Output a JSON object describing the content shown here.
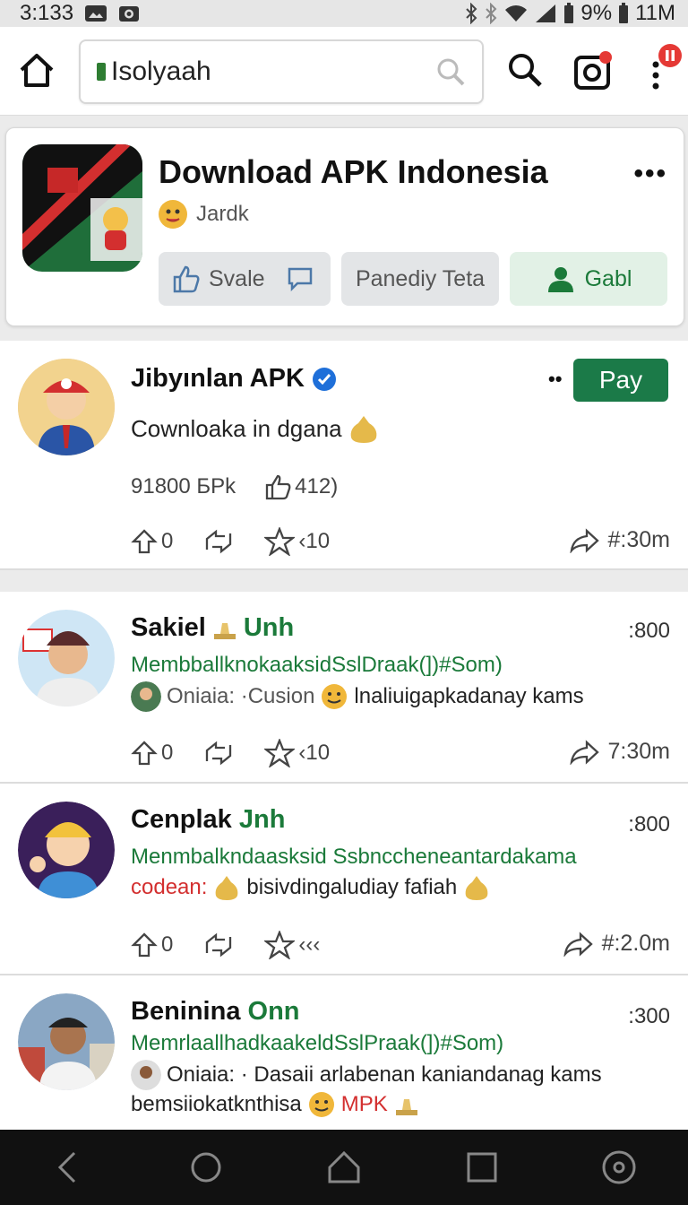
{
  "status": {
    "time": "3:133",
    "battery": "9%",
    "signal": "11M"
  },
  "browser": {
    "url": "Isolyaah"
  },
  "app": {
    "title": "Download APK Indonesia",
    "developer": "Jardk",
    "actions": {
      "share": "Svale",
      "second": "Panediy Teta",
      "get": "Gabl"
    }
  },
  "posts": [
    {
      "name": "Jibyınlan APK",
      "tagline": "Cownloaka in dgana",
      "stats": "91800 БPk",
      "likes": "412)",
      "r1": "0",
      "r2": "",
      "r3": "‹10",
      "time": "#:30m",
      "button": "Pay"
    },
    {
      "name": "Sakiel",
      "suffix": "Unh",
      "count": ":800",
      "line1": "MembballknokaaksidSslDraak(])#Som)",
      "line2a": "Oniaia: ·Cusion",
      "line2b": "lnaliuigapkadanay kams",
      "r1": "0",
      "r3": "‹10",
      "time": "7:30m"
    },
    {
      "name": "Cenplak",
      "suffix": "Jnh",
      "count": ":800",
      "line1": "Menmbalkndaasksid Ssbnccheneantardakama",
      "line2a": "codean:",
      "line2b": "bisivdingaludiay fafiah",
      "r1": "0",
      "r3": "‹‹‹",
      "time": "#:2.0m"
    },
    {
      "name": "Beninina",
      "suffix": "Onn",
      "count": ":300",
      "line1": "MemrlaallhadkaakeldSslPraak(])#Som)",
      "line2a": "Oniaia: · Dasaii arlabenan kaniandanag kams",
      "line3": "bemsiiokatknthisa",
      "line3b": "MPK"
    }
  ]
}
